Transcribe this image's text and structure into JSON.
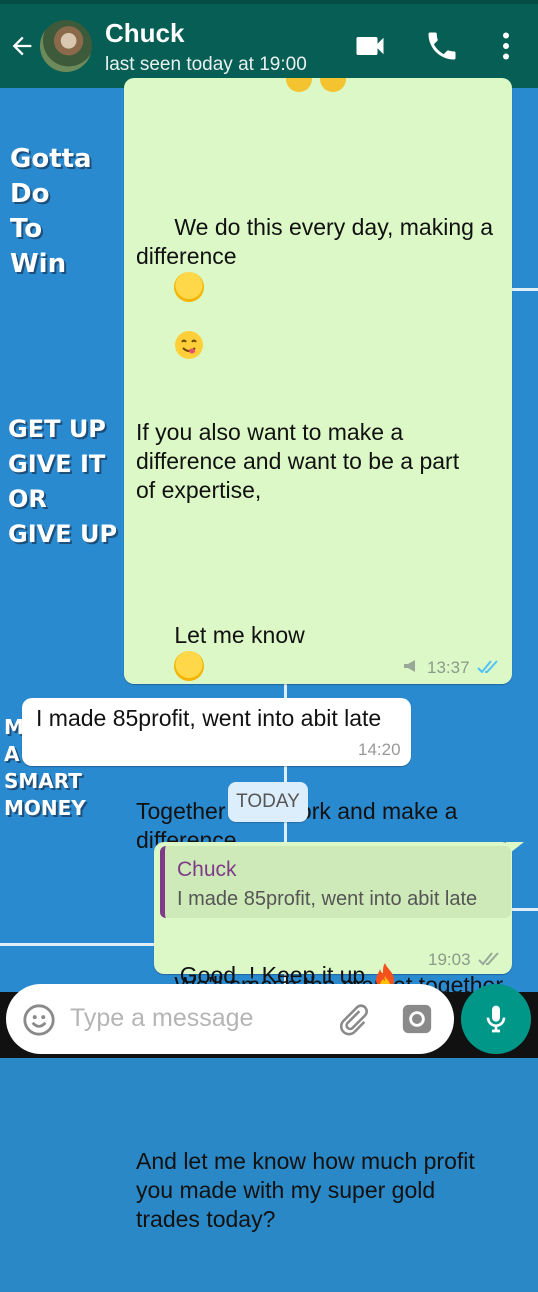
{
  "header": {
    "contact_name": "Chuck",
    "last_seen": "last seen today at 19:00",
    "icons": [
      "back-arrow-icon",
      "video-call-icon",
      "phone-icon",
      "more-vert-icon"
    ]
  },
  "wallpaper": {
    "text1": [
      "Gotta",
      "Do",
      "To",
      "Win"
    ],
    "text2": [
      "GET UP",
      "GIVE IT",
      "OR",
      "GIVE UP"
    ],
    "text3": [
      "M",
      "A",
      "SMART",
      "MONEY"
    ]
  },
  "messages": [
    {
      "id": "m1",
      "direction": "outgoing",
      "paragraphs": [
        {
          "text": "We do this every day, making a\ndifference",
          "emoji": "yum-face"
        },
        {
          "text": "If you also want to make a\ndifference and want to be a part\nof expertise,"
        },
        {
          "text": "Let me know",
          "emoji": "sunglasses-face"
        },
        {
          "text": "Together we'll work and make a\ndifference."
        },
        {
          "text": "We'll smash the market together\neveryday",
          "emoji": "fire"
        },
        {
          "text": "And let me know how much profit\nyou made with my super gold\ntrades today?"
        }
      ],
      "time": "13:37",
      "ticks": "read"
    },
    {
      "id": "m2",
      "direction": "incoming",
      "text": "I made 85profit, went into abit late",
      "time": "14:20"
    },
    {
      "id": "m3",
      "direction": "outgoing",
      "reply_to": {
        "author": "Chuck",
        "text": "I made 85profit, went into abit late"
      },
      "text": "Good  ! Keep it up",
      "emoji": "fire",
      "time": "19:03",
      "ticks": "delivered"
    }
  ],
  "date_divider": "TODAY",
  "composer": {
    "placeholder": "Type a message",
    "icons": [
      "emoji-icon",
      "attach-icon",
      "camera-icon",
      "mic-icon"
    ]
  },
  "colors": {
    "header": "#075e54",
    "outgoing_bubble": "#dcf8c6",
    "incoming_bubble": "#ffffff",
    "wallpaper": "#2a8ad0",
    "accent": "#009688",
    "read_tick": "#4fc3f7",
    "reply_author": "#7e3b87"
  }
}
